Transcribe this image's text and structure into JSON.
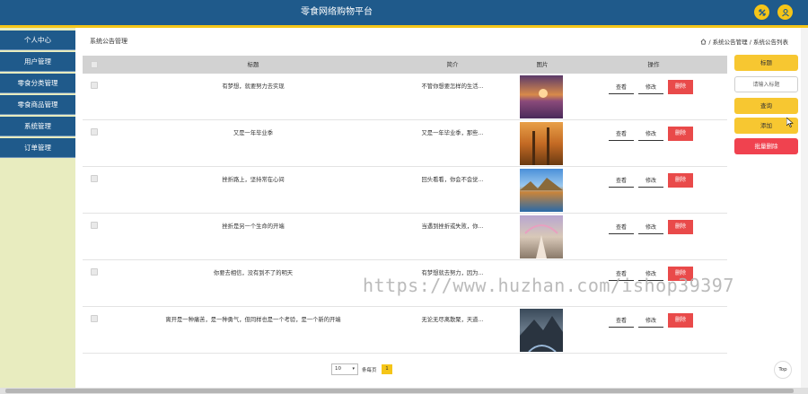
{
  "header": {
    "title": "零食网络购物平台",
    "icons": [
      "expand-icon",
      "user-icon"
    ],
    "accent": "#f5c518",
    "bg": "#1f5a8b"
  },
  "sidebar": {
    "items": [
      {
        "label": "个人中心"
      },
      {
        "label": "用户管理"
      },
      {
        "label": "零食分类管理"
      },
      {
        "label": "零食商品管理"
      },
      {
        "label": "系统管理"
      },
      {
        "label": "订单管理"
      }
    ]
  },
  "breadcrumb": {
    "left": "系统公告管理",
    "right": "/ 系统公告管理 / 系统公告列表"
  },
  "table": {
    "headers": {
      "title": "标题",
      "summary": "简介",
      "image": "图片",
      "actions": "操作"
    },
    "rows": [
      {
        "title": "有梦想，就要努力去实现",
        "summary": "不管你想要怎样的生活..."
      },
      {
        "title": "又是一年毕业季",
        "summary": "又是一年毕业季，那些..."
      },
      {
        "title": "挫折路上，坚持常在心间",
        "summary": "回头看看，你会不会觉..."
      },
      {
        "title": "挫折是另一个生命的开端",
        "summary": "当遇到挫折或失败，你..."
      },
      {
        "title": "你要去相信，没有到不了的明天",
        "summary": "有梦想就去努力，因为..."
      },
      {
        "title": "离开是一种痛苦，是一种勇气，但同样也是一个考验，是一个新的开端",
        "summary": "无论无尽离散聚，天道..."
      }
    ],
    "view_label": "查看",
    "edit_label": "修改",
    "delete_label": "删除"
  },
  "pagination": {
    "page_size": "10",
    "per_page_text": "条每页",
    "current_page": "1"
  },
  "right_panel": {
    "title_button": "标题",
    "search_placeholder": "请输入标题",
    "query_button": "查询",
    "add_button": "添加",
    "batch_delete_button": "批量删除"
  },
  "top_button": "Top",
  "watermark": "https://www.huzhan.com/ishop39397"
}
